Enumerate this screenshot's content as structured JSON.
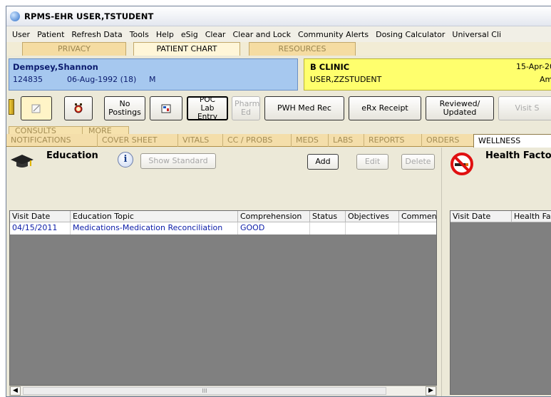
{
  "window": {
    "title": "RPMS-EHR USER,TSTUDENT"
  },
  "menu": [
    {
      "label": "User"
    },
    {
      "label": "Patient"
    },
    {
      "label": "Refresh Data"
    },
    {
      "label": "Tools"
    },
    {
      "label": "Help"
    },
    {
      "label": "eSig"
    },
    {
      "label": "Clear"
    },
    {
      "label": "Clear and Lock"
    },
    {
      "label": "Community Alerts"
    },
    {
      "label": "Dosing Calculator"
    },
    {
      "label": "Universal Cli"
    }
  ],
  "top_tabs": [
    "PRIVACY",
    "PATIENT CHART",
    "RESOURCES"
  ],
  "patient": {
    "name": "Dempsey,Shannon",
    "id": "124835",
    "dob": "06-Aug-1992 (18)",
    "sex": "M"
  },
  "clinic": {
    "name": "B CLINIC",
    "user": "USER,ZZSTUDENT",
    "date": "15-Apr-201",
    "ampm": "Am"
  },
  "toolbar": {
    "no_postings": "No Postings",
    "poc_lab_entry": "POC Lab Entry",
    "pharm_ed": "Pharm Ed",
    "pwh_med_rec": "PWH Med Rec",
    "erx_receipt": "eRx Receipt",
    "reviewed_updated": "Reviewed/ Updated",
    "visit_s": "Visit S"
  },
  "subtabs_row1": [
    "CONSULTS",
    "MORE"
  ],
  "subtabs_row2": [
    "NOTIFICATIONS",
    "COVER SHEET",
    "VITALS",
    "CC / PROBS",
    "MEDS",
    "LABS",
    "REPORTS",
    "ORDERS",
    "WELLNESS"
  ],
  "education": {
    "title": "Education",
    "show_standard": "Show Standard",
    "add": "Add",
    "edit": "Edit",
    "delete": "Delete",
    "columns": [
      "Visit Date",
      "Education Topic",
      "Comprehension",
      "Status",
      "Objectives",
      "Commen"
    ],
    "rows": [
      [
        "04/15/2011",
        "Medications-Medication Reconciliation",
        "GOOD",
        "",
        "",
        ""
      ]
    ]
  },
  "health_factors": {
    "title": "Health Facto",
    "columns": [
      "Visit Date",
      "Health Fac"
    ]
  },
  "scrollbar": {
    "thumb_glyph": "III"
  }
}
